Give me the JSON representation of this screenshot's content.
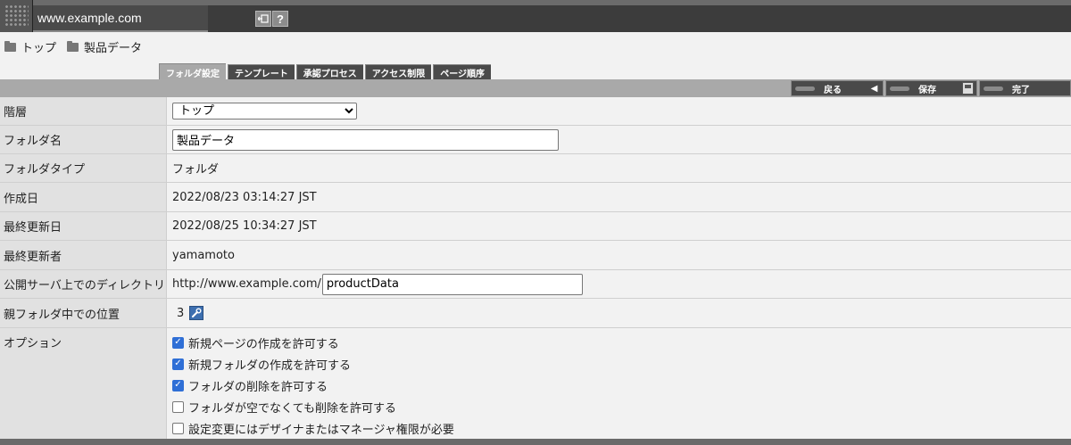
{
  "header": {
    "site": "www.example.com",
    "icons": [
      "exit-icon",
      "help-icon"
    ],
    "help_glyph": "?"
  },
  "breadcrumb": [
    "トップ",
    "製品データ"
  ],
  "tabs": [
    "フォルダ設定",
    "テンプレート",
    "承認プロセス",
    "アクセス制限",
    "ページ順序"
  ],
  "actions": {
    "back": "戻る",
    "save": "保存",
    "done": "完了"
  },
  "form": {
    "hierarchy": {
      "label": "階層",
      "value": "トップ"
    },
    "folder_name": {
      "label": "フォルダ名",
      "value": "製品データ"
    },
    "folder_type": {
      "label": "フォルダタイプ",
      "value": "フォルダ"
    },
    "created": {
      "label": "作成日",
      "value": "2022/08/23 03:14:27 JST"
    },
    "updated": {
      "label": "最終更新日",
      "value": "2022/08/25 10:34:27 JST"
    },
    "updated_by": {
      "label": "最終更新者",
      "value": "yamamoto"
    },
    "directory": {
      "label": "公開サーバ上でのディレクトリ",
      "prefix": "http://www.example.com/",
      "value": "productData"
    },
    "position": {
      "label": "親フォルダ中での位置",
      "value": "3"
    },
    "options": {
      "label": "オプション",
      "items": [
        {
          "text": "新規ページの作成を許可する",
          "checked": true
        },
        {
          "text": "新規フォルダの作成を許可する",
          "checked": true
        },
        {
          "text": "フォルダの削除を許可する",
          "checked": true
        },
        {
          "text": "フォルダが空でなくても削除を許可する",
          "checked": false
        },
        {
          "text": "設定変更にはデザイナまたはマネージャ権限が必要",
          "checked": false
        }
      ]
    }
  }
}
